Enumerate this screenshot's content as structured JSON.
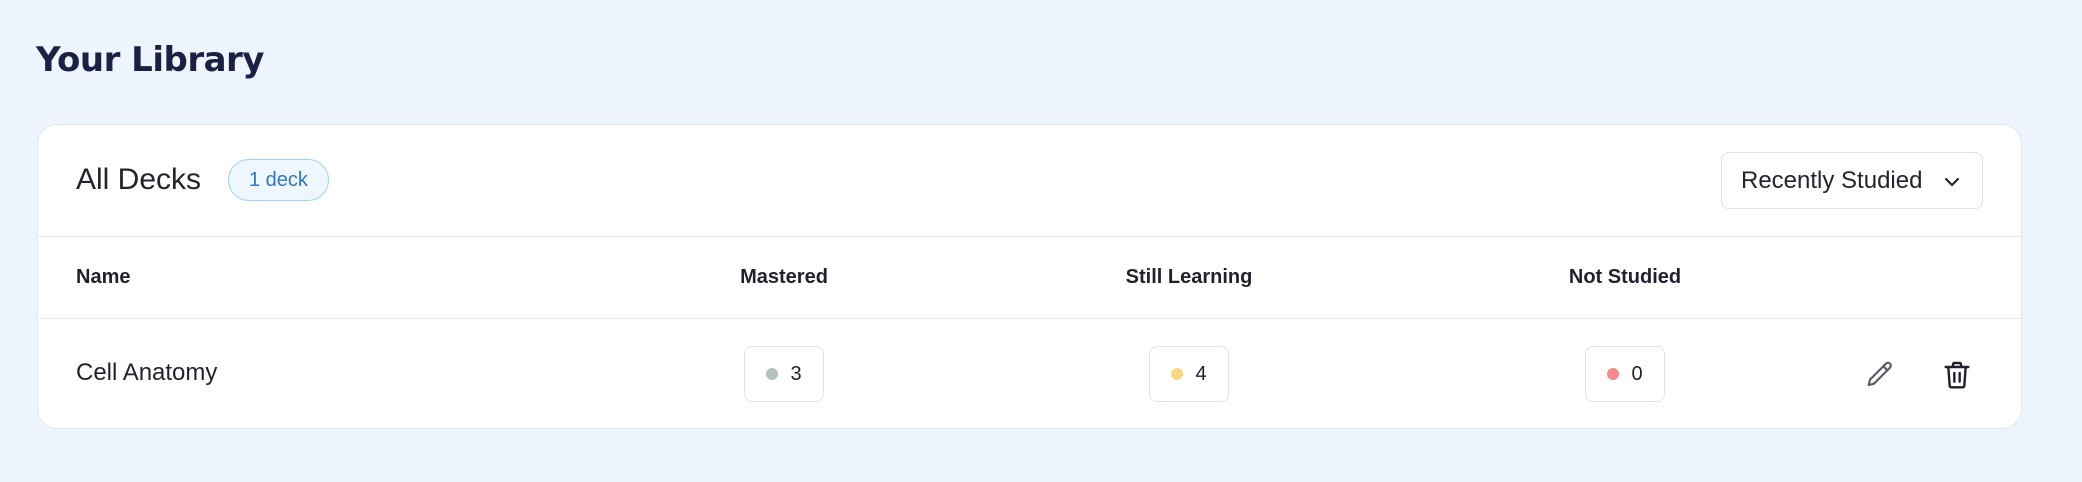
{
  "page": {
    "title": "Your Library"
  },
  "library": {
    "section_title": "All Decks",
    "count_badge": "1 deck",
    "sort": {
      "selected": "Recently Studied"
    }
  },
  "table": {
    "columns": [
      "Name",
      "Mastered",
      "Still Learning",
      "Not Studied"
    ],
    "rows": [
      {
        "name": "Cell Anatomy",
        "mastered": "3",
        "still_learning": "4",
        "not_studied": "0"
      }
    ]
  },
  "colors": {
    "mastered": "#b3c1bd",
    "still_learning": "#fcd783",
    "not_studied": "#f28a8d",
    "badge_text": "#2f78c2"
  },
  "icons": {
    "edit": "pencil-icon",
    "delete": "trash-icon",
    "sort": "chevron-down-icon"
  }
}
